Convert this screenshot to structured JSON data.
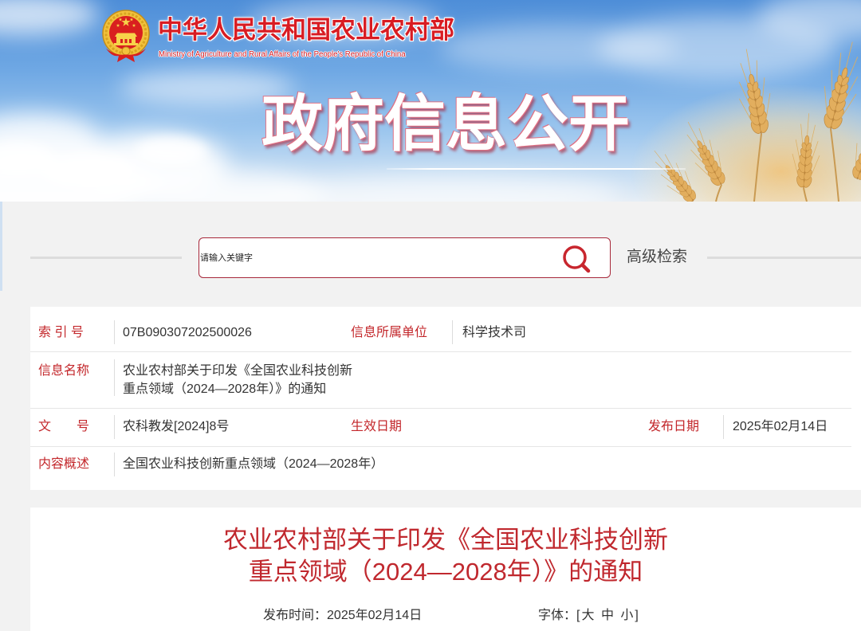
{
  "header": {
    "org_name": "中华人民共和国农业农村部",
    "org_name_en": "Ministry of Agriculture and Rural Affairs of the People's Republic of China",
    "banner_title": "政府信息公开"
  },
  "search": {
    "placeholder": "请输入关键字",
    "advanced_label": "高级检索"
  },
  "info_table": {
    "index": {
      "label": "索 引 号",
      "value": "07B090307202500026"
    },
    "unit": {
      "label": "信息所属单位",
      "value": "科学技术司"
    },
    "name": {
      "label": "信息名称",
      "value_lines": [
        "农业农村部关于印发《全国农业科技创新",
        "重点领域（2024—2028年）》的通知"
      ]
    },
    "doc_number": {
      "label": "文　　号",
      "value": "农科教发[2024]8号"
    },
    "effective_date": {
      "label": "生效日期"
    },
    "publish_date": {
      "label": "发布日期",
      "value": "2025年02月14日"
    },
    "summary": {
      "label": "内容概述",
      "value": "全国农业科技创新重点领域（2024—2028年）"
    }
  },
  "article": {
    "title_lines": [
      "农业农村部关于印发《全国农业科技创新",
      "重点领域（2024—2028年）》的通知"
    ],
    "publish_time_label": "发布时间：",
    "publish_time_value": "2025年02月14日",
    "font_size": {
      "label": "字体：",
      "open": "[",
      "options": [
        "大",
        "中",
        "小"
      ],
      "close": "]"
    }
  },
  "icons": {
    "emblem": "national-emblem-icon",
    "search": "search-icon"
  },
  "colors": {
    "accent_red": "#c3272b",
    "title_red": "#c0282e",
    "search_border": "#a7283a",
    "text": "#333333",
    "page_bg": "#f2f2f2",
    "sky_blue": "#4e8ed8"
  }
}
